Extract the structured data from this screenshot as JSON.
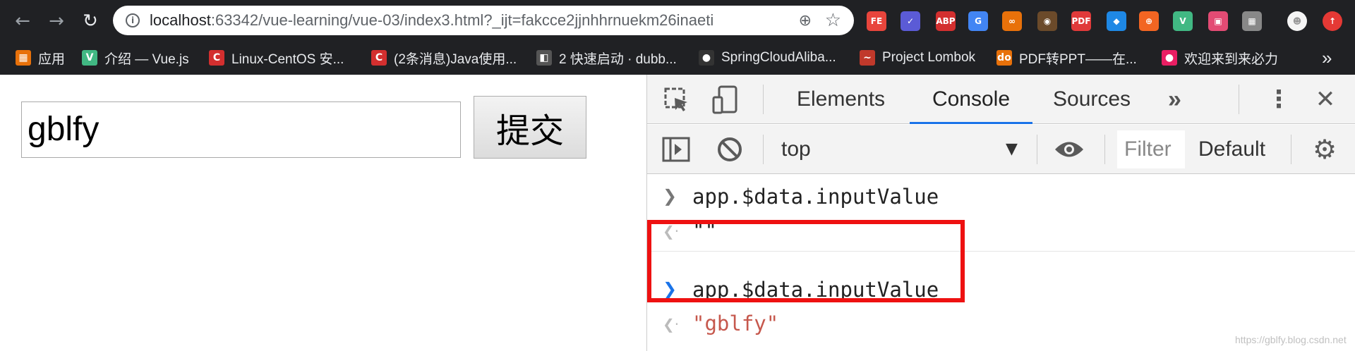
{
  "browser": {
    "url_host": "localhost",
    "url_rest": ":63342/vue-learning/vue-03/index3.html?_ijt=fakcce2jjnhhrnuekm26inaeti",
    "extensions": [
      {
        "name": "fe-helper-icon",
        "label": "FE",
        "color": "#e8453c"
      },
      {
        "name": "check-circle-icon",
        "label": "✓",
        "color": "#5b5bd6"
      },
      {
        "name": "adblock-icon",
        "label": "ABP",
        "color": "#d32f2f"
      },
      {
        "name": "translate-icon",
        "label": "G",
        "color": "#4285f4"
      },
      {
        "name": "infinity-icon",
        "label": "∞",
        "color": "#e8710a"
      },
      {
        "name": "tampermonkey-icon",
        "label": "◉",
        "color": "#6b4a2a"
      },
      {
        "name": "pdf-icon",
        "label": "PDF",
        "color": "#e03a3a"
      },
      {
        "name": "octotree-icon",
        "label": "◆",
        "color": "#1e88e5"
      },
      {
        "name": "lifebuoy-icon",
        "label": "⊕",
        "color": "#f26522"
      },
      {
        "name": "vue-devtools-icon",
        "label": "V",
        "color": "#41b883"
      },
      {
        "name": "bilibili-icon",
        "label": "▣",
        "color": "#e34b74"
      },
      {
        "name": "extension-puzzle-icon",
        "label": "▦",
        "color": "#888888"
      },
      {
        "name": "avatar-icon",
        "label": "☻",
        "color": "#f5f5f5"
      },
      {
        "name": "update-icon",
        "label": "↑",
        "color": "#e53935"
      }
    ],
    "bookmarks": [
      {
        "name": "bookmark-apps",
        "label": "应用",
        "icon": "▦",
        "color": "#e8710a"
      },
      {
        "name": "bookmark-vue",
        "label": "介绍 — Vue.js",
        "icon": "V",
        "color": "#41b883"
      },
      {
        "name": "bookmark-linux-centos",
        "label": "Linux-CentOS 安...",
        "icon": "C",
        "color": "#d32f2f"
      },
      {
        "name": "bookmark-java",
        "label": "(2条消息)Java使用...",
        "icon": "C",
        "color": "#d32f2f"
      },
      {
        "name": "bookmark-dubbo",
        "label": "2 快速启动 · dubb...",
        "icon": "◧",
        "color": "#555555"
      },
      {
        "name": "bookmark-springcloud",
        "label": "SpringCloudAliba...",
        "icon": "●",
        "color": "#333333"
      },
      {
        "name": "bookmark-lombok",
        "label": "Project Lombok",
        "icon": "~",
        "color": "#c0392b"
      },
      {
        "name": "bookmark-pdf-ppt",
        "label": "PDF转PPT——在...",
        "icon": "do",
        "color": "#e8710a"
      },
      {
        "name": "bookmark-laibili",
        "label": "欢迎来到来必力",
        "icon": "●",
        "color": "#e91e63"
      }
    ],
    "more_bookmarks": "»"
  },
  "page": {
    "input_value": "gblfy",
    "submit_label": "提交"
  },
  "devtools": {
    "tabs": [
      "Elements",
      "Console",
      "Sources"
    ],
    "active_tab": "Console",
    "more_tabs": "»",
    "context": "top",
    "filter_placeholder": "Filter",
    "levels": "Default",
    "console": [
      {
        "kind": "input",
        "text": "app.$data.inputValue"
      },
      {
        "kind": "output",
        "text": "\"\""
      },
      {
        "kind": "input",
        "text": "app.$data.inputValue"
      },
      {
        "kind": "output",
        "text": "\"gblfy\""
      }
    ],
    "highlight_color": "#ee1111"
  },
  "watermark": "https://gblfy.blog.csdn.net"
}
